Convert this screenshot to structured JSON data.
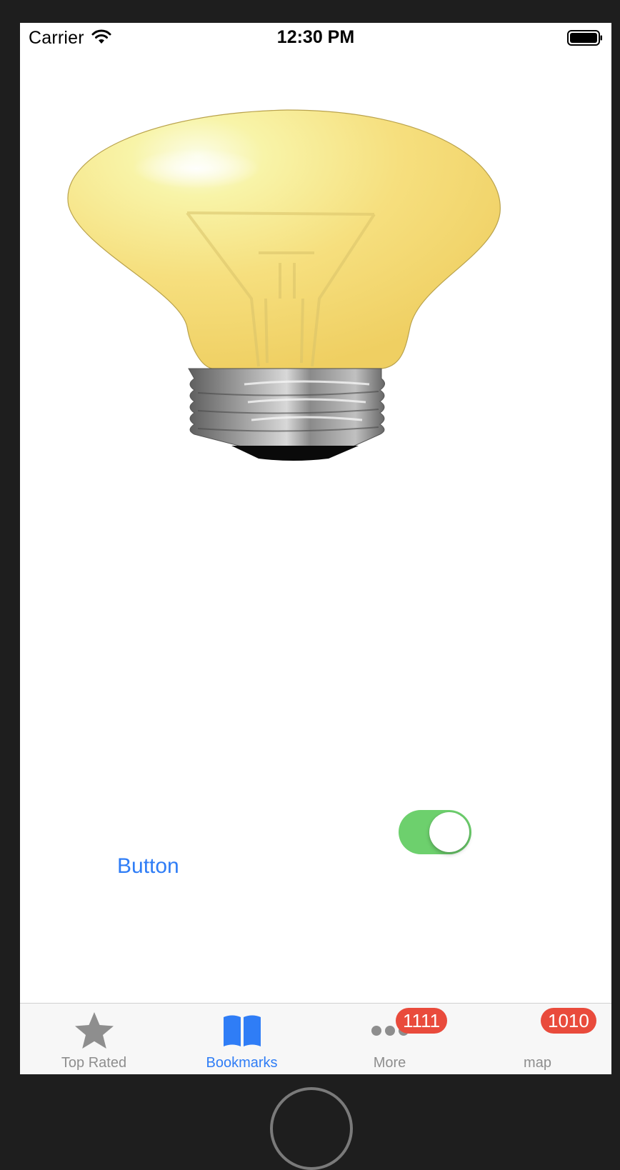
{
  "status_bar": {
    "carrier": "Carrier",
    "time": "12:30 PM",
    "wifi_icon": "wifi-icon",
    "battery_icon": "battery-full-icon"
  },
  "main": {
    "image": "light-bulb-on",
    "button_label": "Button",
    "toggle_on": true,
    "toggle_color": "#6dd06d",
    "accent_color": "#2f7df6"
  },
  "tab_bar": {
    "selected": "Bookmarks",
    "tabs": [
      {
        "label": "Top Rated",
        "icon": "star-icon",
        "badge": ""
      },
      {
        "label": "Bookmarks",
        "icon": "book-open-icon",
        "badge": ""
      },
      {
        "label": "More",
        "icon": "more-dots-icon",
        "badge": "1111"
      },
      {
        "label": "map",
        "icon": "",
        "badge": "1010"
      }
    ],
    "badge_color": "#e94b3c"
  }
}
